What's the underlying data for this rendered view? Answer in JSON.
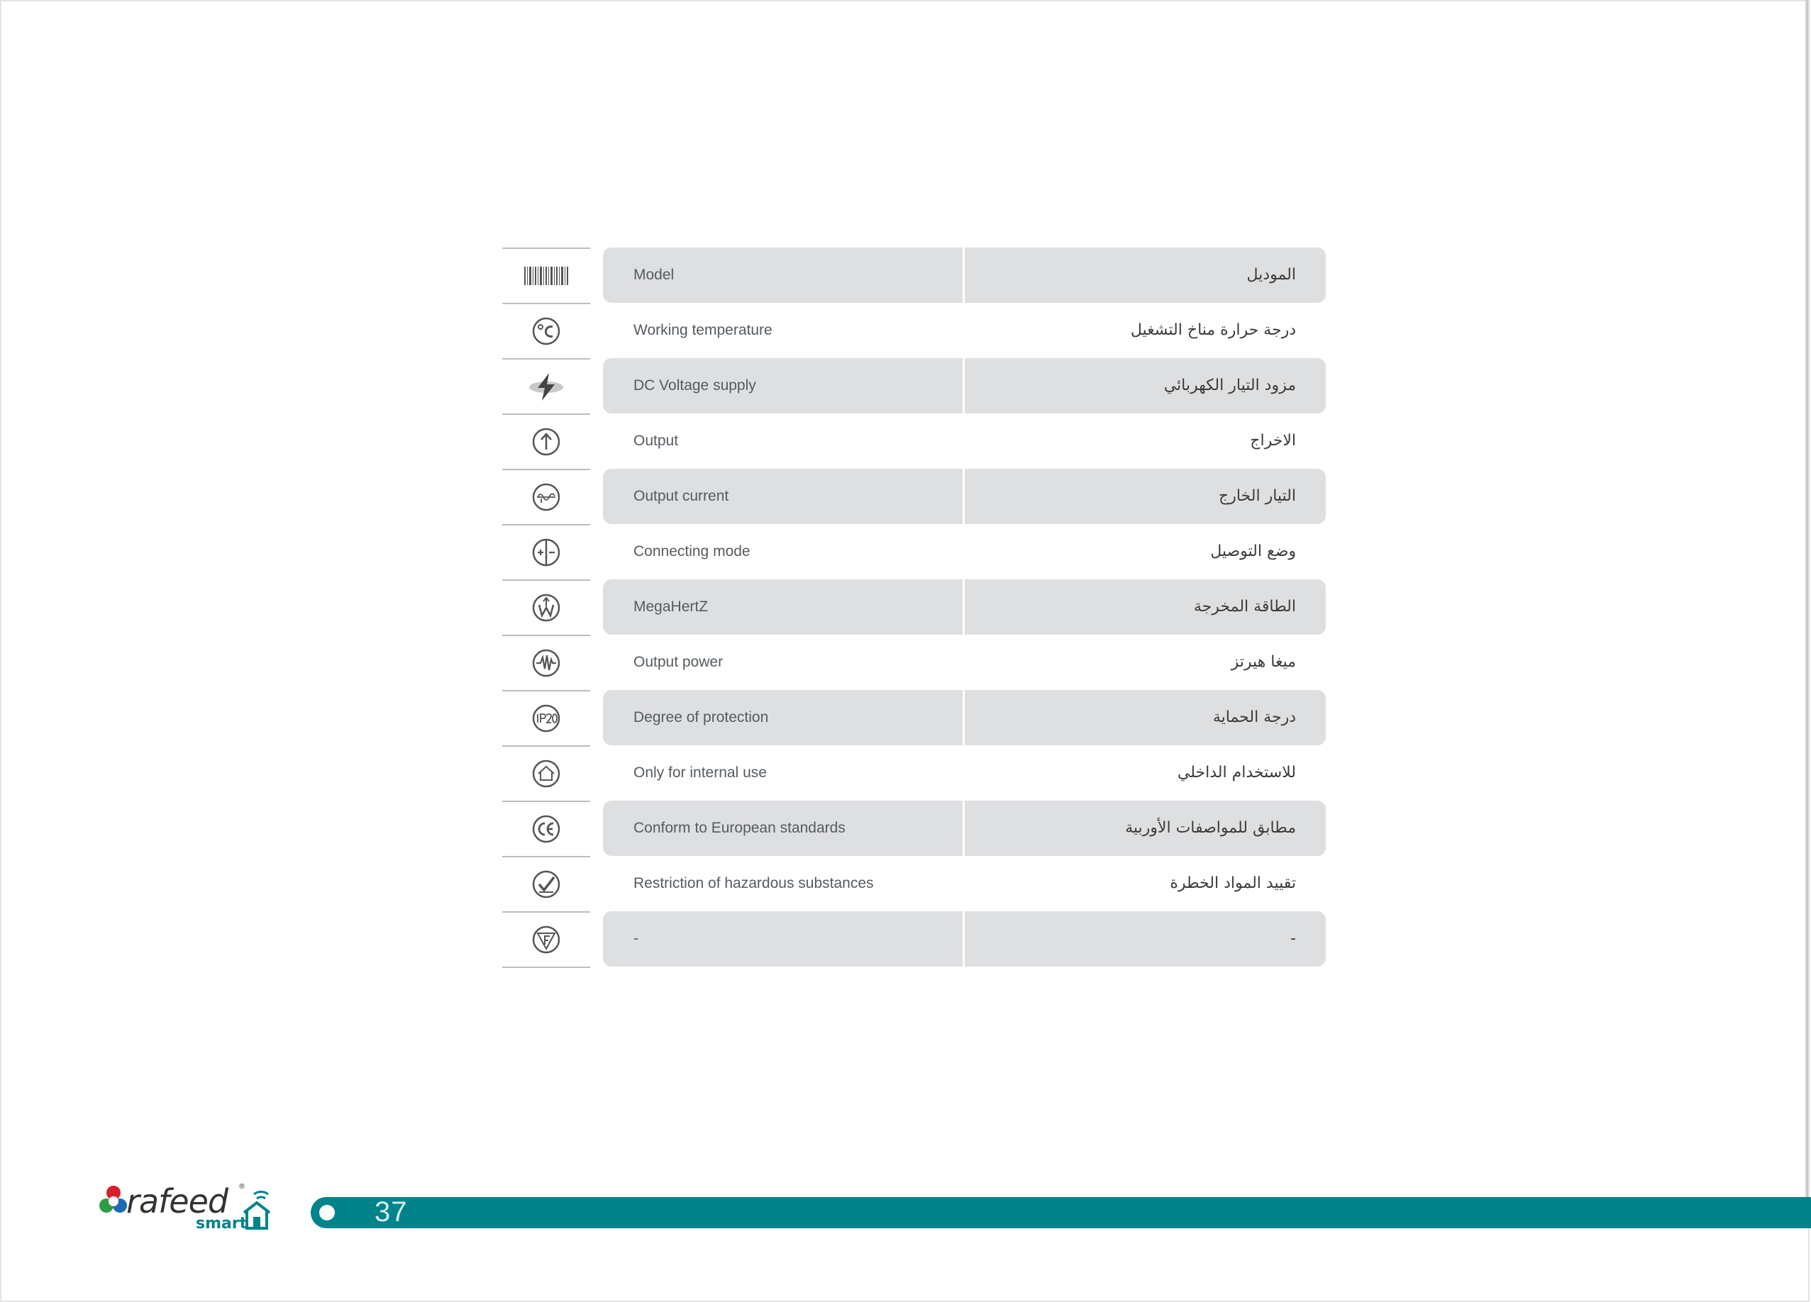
{
  "page": {
    "number": "37"
  },
  "logo": {
    "brand": "rafeed",
    "sub": "smart"
  },
  "rows": [
    {
      "icon": "barcode-icon",
      "en": "Model",
      "ar": "الموديل"
    },
    {
      "icon": "celsius-icon",
      "en": "Working temperature",
      "ar": "درجة حرارة مناخ التشغيل"
    },
    {
      "icon": "lightning-icon",
      "en": "DC Voltage supply",
      "ar": "مزود التيار الكهربائي"
    },
    {
      "icon": "arrow-up-circle-icon",
      "en": "Output",
      "ar": "الاخراج"
    },
    {
      "icon": "sine-wave-circle-icon",
      "en": "Output current",
      "ar": "التيار الخارج"
    },
    {
      "icon": "plus-minus-circle-icon",
      "en": "Connecting mode",
      "ar": "وضع التوصيل"
    },
    {
      "icon": "watt-circle-icon",
      "en": "MegaHertZ",
      "ar": "الطاقة المخرجة"
    },
    {
      "icon": "frequency-circle-icon",
      "en": "Output power",
      "ar": "ميغا هيرتز"
    },
    {
      "icon": "ip20-icon",
      "en": "Degree of protection",
      "ar": "درجة الحماية"
    },
    {
      "icon": "house-circle-icon",
      "en": "Only for internal use",
      "ar": "للاستخدام الداخلي"
    },
    {
      "icon": "ce-mark-icon",
      "en": "Conform to European standards",
      "ar": "مطابق للمواصفات الأوربية"
    },
    {
      "icon": "check-circle-icon",
      "en": "Restriction of hazardous substances",
      "ar": "تقييد المواد الخطرة"
    },
    {
      "icon": "f-mark-icon",
      "en": "-",
      "ar": "-"
    }
  ],
  "colors": {
    "shade": "#dedfe1",
    "footer": "#00838b",
    "text": "#555b60"
  }
}
